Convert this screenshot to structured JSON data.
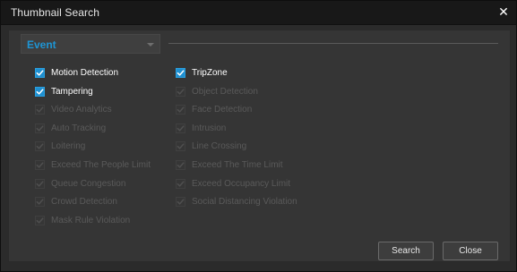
{
  "window": {
    "title": "Thumbnail Search",
    "close_glyph": "✕"
  },
  "filter": {
    "selected": "Event"
  },
  "options": {
    "col1": [
      {
        "label": "Motion Detection",
        "checked": true,
        "enabled": true
      },
      {
        "label": "Tampering",
        "checked": true,
        "enabled": true
      },
      {
        "label": "Video Analytics",
        "checked": true,
        "enabled": false
      },
      {
        "label": "Auto Tracking",
        "checked": true,
        "enabled": false
      },
      {
        "label": "Loitering",
        "checked": true,
        "enabled": false
      },
      {
        "label": "Exceed The People Limit",
        "checked": true,
        "enabled": false
      },
      {
        "label": "Queue Congestion",
        "checked": true,
        "enabled": false
      },
      {
        "label": "Crowd Detection",
        "checked": true,
        "enabled": false
      },
      {
        "label": "Mask Rule Violation",
        "checked": true,
        "enabled": false
      }
    ],
    "col2": [
      {
        "label": "TripZone",
        "checked": true,
        "enabled": true
      },
      {
        "label": "Object Detection",
        "checked": true,
        "enabled": false
      },
      {
        "label": "Face Detection",
        "checked": true,
        "enabled": false
      },
      {
        "label": "Intrusion",
        "checked": true,
        "enabled": false
      },
      {
        "label": "Line Crossing",
        "checked": true,
        "enabled": false
      },
      {
        "label": "Exceed The Time Limit",
        "checked": true,
        "enabled": false
      },
      {
        "label": "Exceed Occupancy Limit",
        "checked": true,
        "enabled": false
      },
      {
        "label": "Social Distancing Violation",
        "checked": true,
        "enabled": false
      }
    ]
  },
  "buttons": {
    "search": "Search",
    "close": "Close"
  },
  "colors": {
    "accent": "#1e95d4",
    "enabled_text": "#ffffff",
    "disabled_text": "#5a5a5a"
  },
  "icons": {
    "checkbox": "checkmark-icon",
    "dropdown": "chevron-down-icon",
    "close": "close-icon"
  }
}
